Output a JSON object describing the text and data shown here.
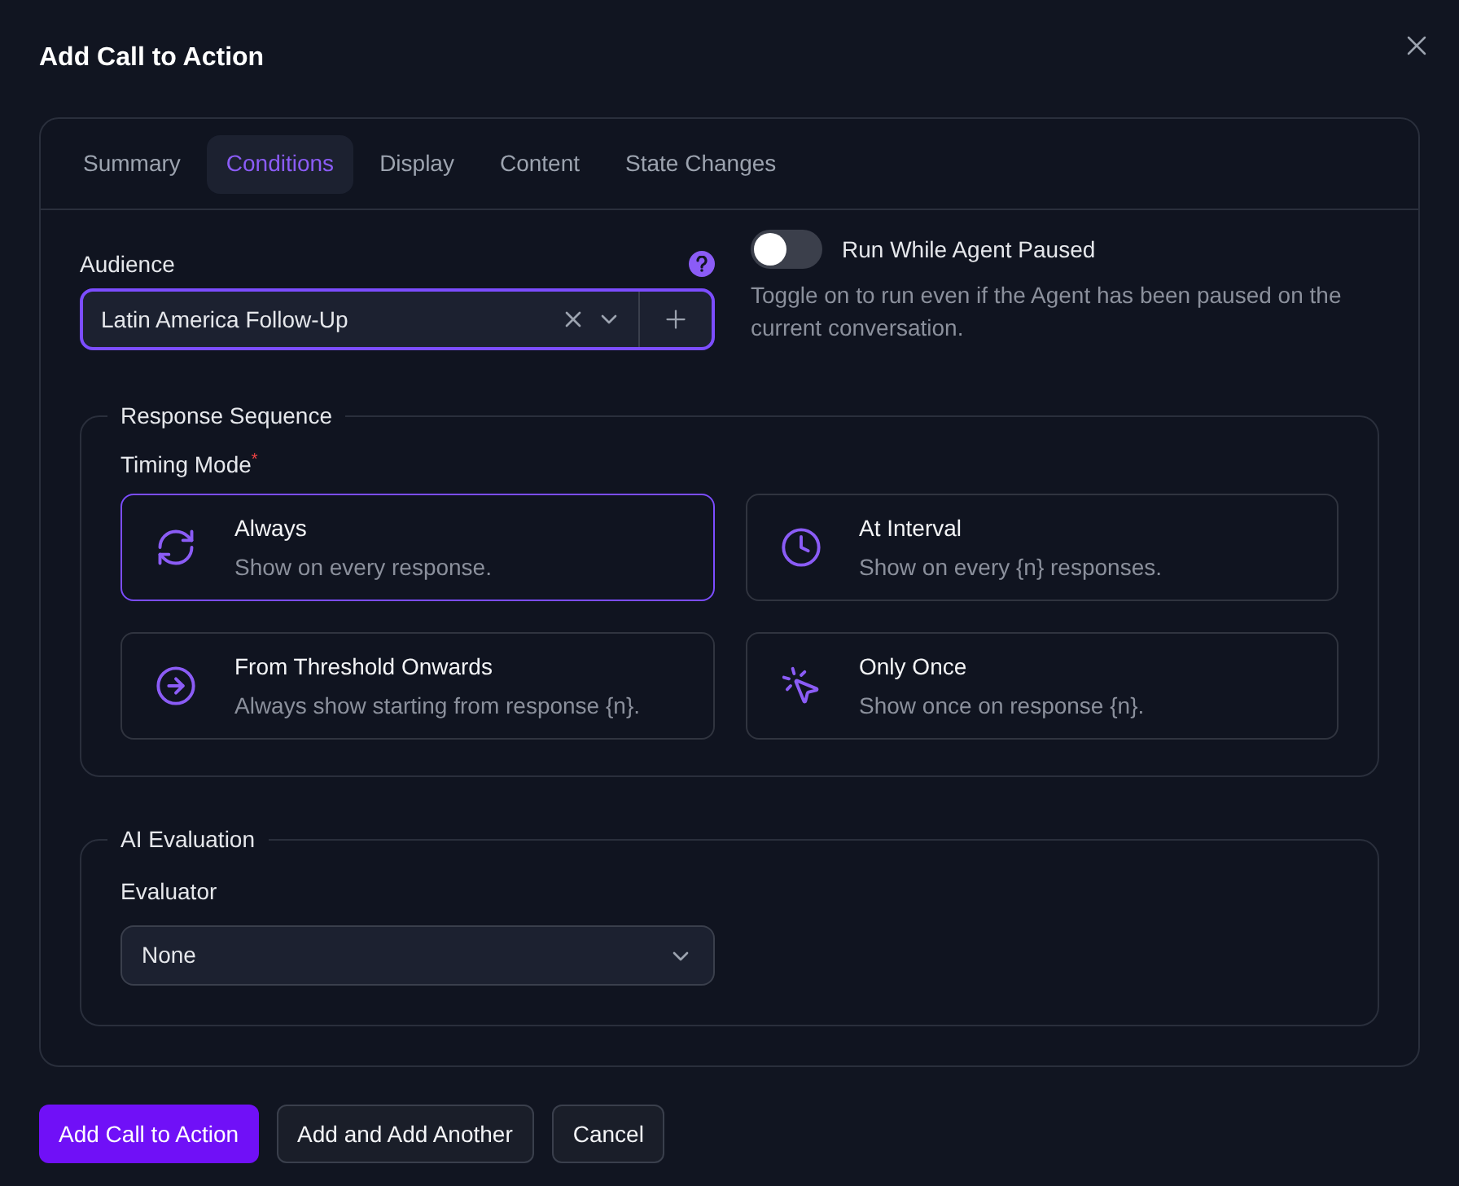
{
  "dialog": {
    "title": "Add Call to Action"
  },
  "tabs": [
    {
      "label": "Summary",
      "selected": false
    },
    {
      "label": "Conditions",
      "selected": true
    },
    {
      "label": "Display",
      "selected": false
    },
    {
      "label": "Content",
      "selected": false
    },
    {
      "label": "State Changes",
      "selected": false
    }
  ],
  "audience": {
    "label": "Audience",
    "value": "Latin America Follow-Up",
    "focused": true
  },
  "pause_toggle": {
    "label": "Run While Agent Paused",
    "on": false,
    "description": "Toggle on to run even if the Agent has been paused on the current conversation."
  },
  "response_sequence": {
    "legend": "Response Sequence",
    "field_label": "Timing Mode",
    "required_mark": "*",
    "options": [
      {
        "kind": "always",
        "title": "Always",
        "description": "Show on every response.",
        "selected": true
      },
      {
        "kind": "interval",
        "title": "At Interval",
        "description": "Show on every {n} responses.",
        "selected": false
      },
      {
        "kind": "threshold",
        "title": "From Threshold Onwards",
        "description": "Always show starting from response {n}.",
        "selected": false
      },
      {
        "kind": "once",
        "title": "Only Once",
        "description": "Show once on response {n}.",
        "selected": false
      }
    ]
  },
  "ai_evaluation": {
    "legend": "AI Evaluation",
    "field_label": "Evaluator",
    "value": "None"
  },
  "buttons": [
    {
      "label": "Add Call to Action",
      "kind": "primary"
    },
    {
      "label": "Add and Add Another",
      "kind": "secondary"
    },
    {
      "label": "Cancel",
      "kind": "secondary"
    }
  ]
}
